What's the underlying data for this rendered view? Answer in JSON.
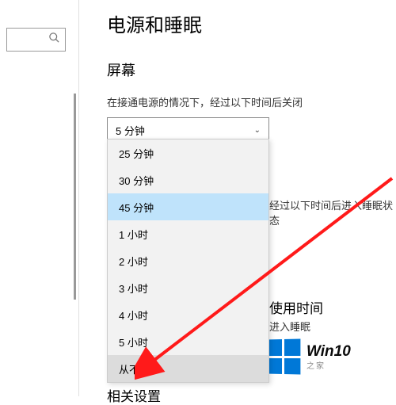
{
  "page_title": "电源和睡眠",
  "screen": {
    "section": "屏幕",
    "label": "在接通电源的情况下，经过以下时间后关闭",
    "selected": "5 分钟"
  },
  "dropdown": {
    "items": [
      {
        "label": "25 分钟",
        "state": ""
      },
      {
        "label": "30 分钟",
        "state": ""
      },
      {
        "label": "45 分钟",
        "state": "selected"
      },
      {
        "label": "1 小时",
        "state": ""
      },
      {
        "label": "2 小时",
        "state": ""
      },
      {
        "label": "3 小时",
        "state": ""
      },
      {
        "label": "4 小时",
        "state": ""
      },
      {
        "label": "5 小时",
        "state": ""
      },
      {
        "label": "从不",
        "state": "hover"
      }
    ]
  },
  "sleep_hint": "经过以下时间后进入睡眠状态",
  "usage": {
    "title": "使用时间",
    "sub": "进入睡眠"
  },
  "related": "相关设置",
  "watermark": {
    "brand": "Win10",
    "sub": "之家"
  }
}
